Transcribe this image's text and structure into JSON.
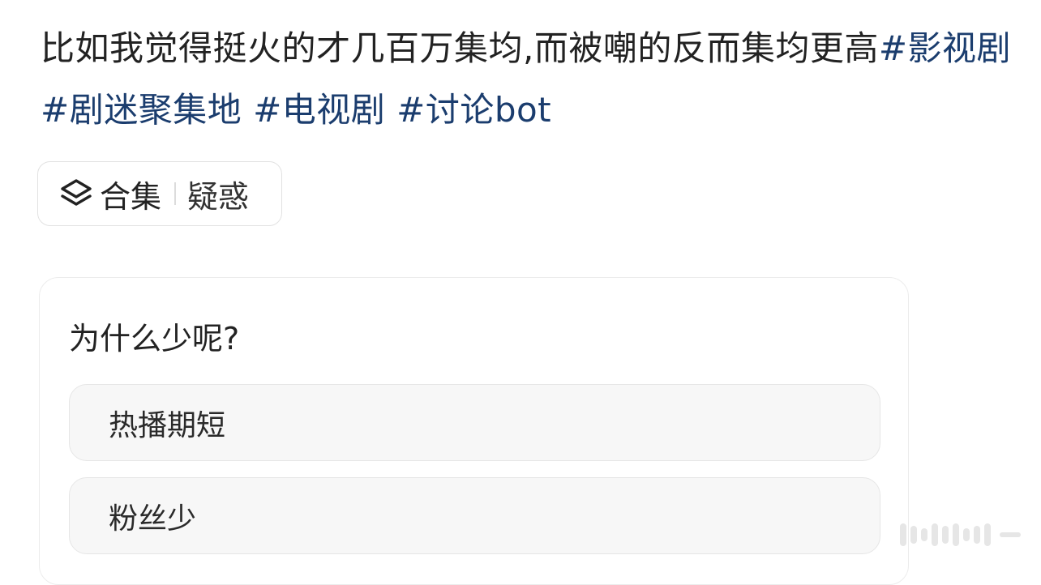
{
  "post": {
    "text": "比如我觉得挺火的才几百万集均,而被嘲的反而集均更高",
    "hashtags": [
      "#影视剧",
      "#剧迷聚集地",
      "#电视剧",
      "#讨论bot"
    ]
  },
  "collection": {
    "icon": "layers-icon",
    "label": "合集",
    "name": "疑惑"
  },
  "poll": {
    "question": "为什么少呢?",
    "options": [
      "热播期短",
      "粉丝少"
    ]
  },
  "colors": {
    "hashtag": "#1b3d6e",
    "text": "#222222",
    "option_bg": "#f7f7f7",
    "border": "#e6e6e6"
  }
}
